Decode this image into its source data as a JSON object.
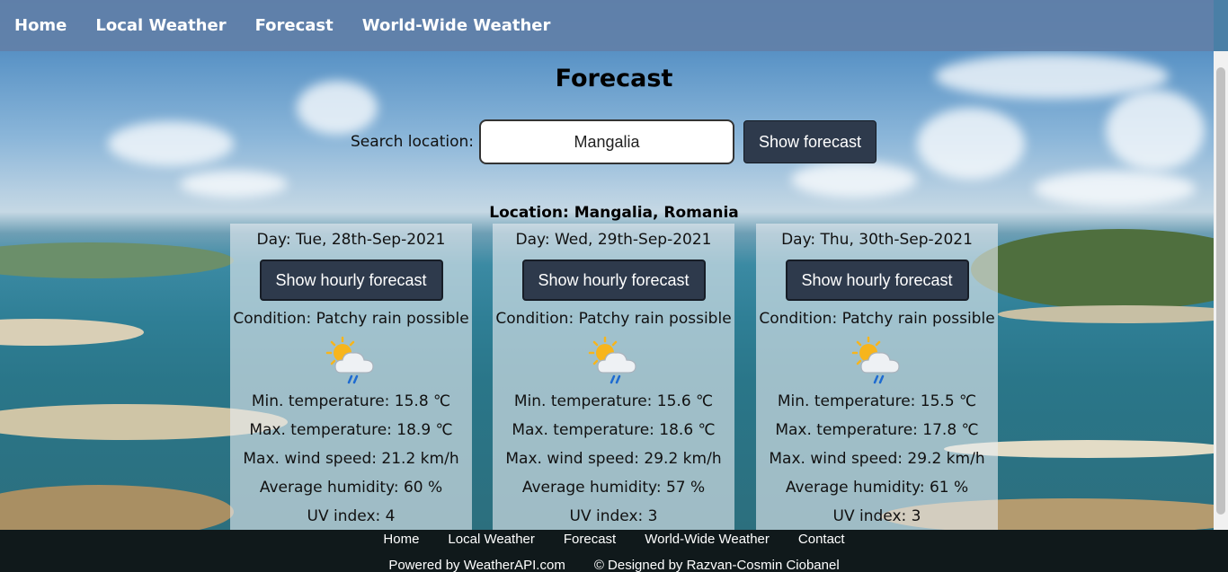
{
  "nav": {
    "items": [
      "Home",
      "Local Weather",
      "Forecast",
      "World-Wide Weather"
    ]
  },
  "page": {
    "title": "Forecast"
  },
  "search": {
    "label": "Search location:",
    "value": "Mangalia",
    "button": "Show forecast"
  },
  "location_text": "Location: Mangalia, Romania",
  "days": [
    {
      "day": "Day: Tue, 28th-Sep-2021",
      "button": "Show hourly forecast",
      "condition": "Condition: Patchy rain possible",
      "icon": "patchy-rain-icon",
      "min_temp": "Min. temperature: 15.8 ℃",
      "max_temp": "Max. temperature: 18.9 ℃",
      "wind": "Max. wind speed: 21.2 km/h",
      "humidity": "Average humidity: 60 %",
      "uv": "UV index: 4"
    },
    {
      "day": "Day: Wed, 29th-Sep-2021",
      "button": "Show hourly forecast",
      "condition": "Condition: Patchy rain possible",
      "icon": "patchy-rain-icon",
      "min_temp": "Min. temperature: 15.6 ℃",
      "max_temp": "Max. temperature: 18.6 ℃",
      "wind": "Max. wind speed: 29.2 km/h",
      "humidity": "Average humidity: 57 %",
      "uv": "UV index: 3"
    },
    {
      "day": "Day: Thu, 30th-Sep-2021",
      "button": "Show hourly forecast",
      "condition": "Condition: Patchy rain possible",
      "icon": "patchy-rain-icon",
      "min_temp": "Min. temperature: 15.5 ℃",
      "max_temp": "Max. temperature: 17.8 ℃",
      "wind": "Max. wind speed: 29.2 km/h",
      "humidity": "Average humidity: 61 %",
      "uv": "UV index: 3"
    }
  ],
  "footer": {
    "links": [
      "Home",
      "Local Weather",
      "Forecast",
      "World-Wide Weather",
      "Contact"
    ],
    "powered_by": "Powered by WeatherAPI.com",
    "designed_by": "© Designed by Razvan-Cosmin Ciobanel"
  },
  "colors": {
    "nav_bg": "#6280a8",
    "button_bg": "#2e3a4c",
    "footer_bg": "#10191b"
  }
}
